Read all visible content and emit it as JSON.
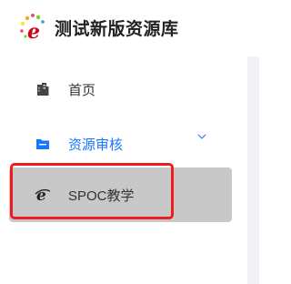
{
  "brand": {
    "title": "测试新版资源库",
    "logo_icon": "flower-e-logo"
  },
  "sidebar": {
    "items": [
      {
        "label": "首页",
        "icon": "building-icon",
        "active": false
      },
      {
        "label": "资源审核",
        "icon": "folder-icon",
        "active": true,
        "expanded": false,
        "submenu_icon": "chevron-down-icon"
      },
      {
        "label": "SPOC教学",
        "icon": "ie-icon",
        "selected": true,
        "highlighted": true
      }
    ]
  },
  "colors": {
    "accent": "#1677ff",
    "selected_bg": "#c8c8c8",
    "highlight_border": "#ee1c1c",
    "text": "#333333"
  }
}
